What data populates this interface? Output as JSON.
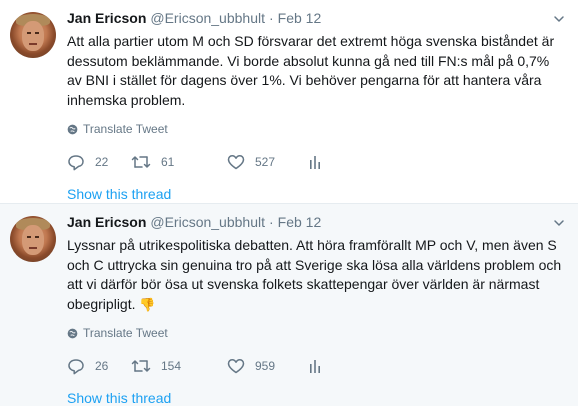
{
  "tweets": [
    {
      "author_name": "Jan Ericson",
      "handle": "@Ericson_ubbhult",
      "date": "Feb 12",
      "text": "Att alla partier utom M och SD försvarar det extremt höga svenska  biståndet är dessutom beklämmande. Vi borde absolut kunna gå ned till FN:s mål på 0,7% av BNI i stället för dagens över 1%. Vi behöver pengarna för att hantera våra inhemska problem.",
      "translate_label": "Translate Tweet",
      "reply_count": "22",
      "retweet_count": "61",
      "like_count": "527",
      "show_thread": "Show this thread"
    },
    {
      "author_name": "Jan Ericson",
      "handle": "@Ericson_ubbhult",
      "date": "Feb 12",
      "text": "Lyssnar på utrikespolitiska debatten. Att höra framförallt MP och V, men även S och C uttrycka sin genuina tro på att Sverige ska lösa alla världens problem och att vi därför bör ösa ut svenska folkets skattepengar över världen är närmast obegripligt.",
      "emoji": "👎",
      "translate_label": "Translate Tweet",
      "reply_count": "26",
      "retweet_count": "154",
      "like_count": "959",
      "show_thread": "Show this thread"
    }
  ],
  "colors": {
    "link": "#1da1f2",
    "muted": "#657786",
    "text": "#14171a",
    "divider": "#e6ecf0"
  }
}
